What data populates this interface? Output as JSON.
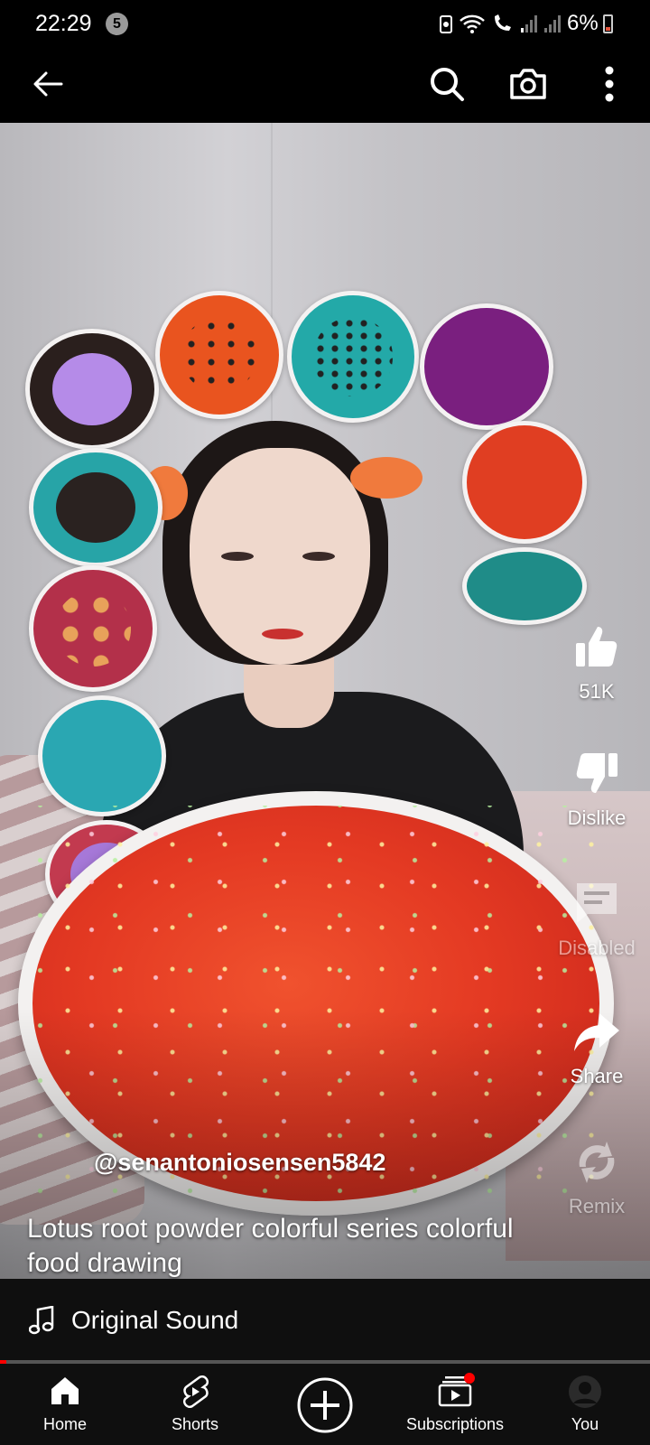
{
  "status_bar": {
    "time": "22:29",
    "notification_count": "5",
    "battery": "6%"
  },
  "top_bar": {
    "back_icon": "arrow-left-icon",
    "search_icon": "search-icon",
    "camera_icon": "camera-icon",
    "more_icon": "more-vertical-icon"
  },
  "video": {
    "channel": "@senantoniosensen5842",
    "title": "Lotus root powder colorful series colorful food drawing"
  },
  "actions": {
    "like_count": "51K",
    "dislike_label": "Dislike",
    "comments_label": "Disabled",
    "share_label": "Share",
    "remix_label": "Remix"
  },
  "sound": {
    "label": "Original Sound"
  },
  "progress": {
    "percent": 1
  },
  "nav": {
    "home": "Home",
    "shorts": "Shorts",
    "create_icon": "plus-circle-icon",
    "subscriptions": "Subscriptions",
    "you": "You"
  },
  "colors": {
    "accent": "#ff0000",
    "background": "#0f0f0f"
  }
}
